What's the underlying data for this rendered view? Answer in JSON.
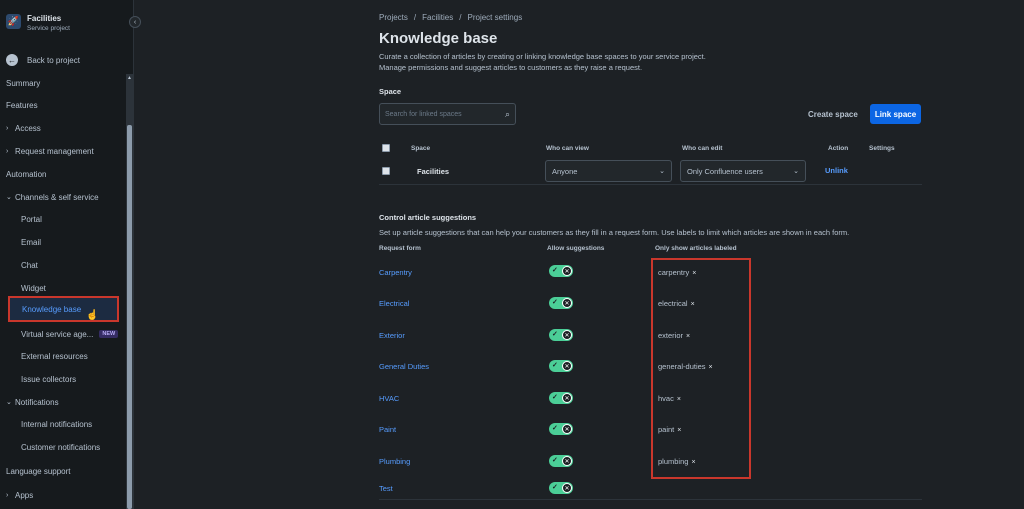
{
  "sidebar": {
    "project_name": "Facilities",
    "project_type": "Service project",
    "collapse_glyph": "‹",
    "back_label": "Back to project",
    "items": [
      {
        "label": "Summary"
      },
      {
        "label": "Features"
      },
      {
        "label": "Access"
      },
      {
        "label": "Request management"
      },
      {
        "label": "Automation"
      },
      {
        "label": "Channels & self service"
      },
      {
        "label": "Portal"
      },
      {
        "label": "Email"
      },
      {
        "label": "Chat"
      },
      {
        "label": "Widget"
      },
      {
        "label": "Knowledge base"
      },
      {
        "label": "Virtual service age..."
      },
      {
        "label": "External resources"
      },
      {
        "label": "Issue collectors"
      },
      {
        "label": "Notifications"
      },
      {
        "label": "Internal notifications"
      },
      {
        "label": "Customer notifications"
      },
      {
        "label": "Language support"
      },
      {
        "label": "Apps"
      }
    ],
    "new_badge": "NEW"
  },
  "breadcrumb": [
    "Projects",
    "Facilities",
    "Project settings"
  ],
  "page": {
    "title": "Knowledge base",
    "description_line1": "Curate a collection of articles by creating or linking knowledge base spaces to your service project.",
    "description_line2": "Manage permissions and suggest articles to customers as they raise a request."
  },
  "space": {
    "label": "Space",
    "search_placeholder": "Search for linked spaces",
    "create_button": "Create space",
    "link_button": "Link space",
    "headers": {
      "space": "Space",
      "who_view": "Who can view",
      "who_edit": "Who can edit",
      "action": "Action",
      "settings": "Settings"
    },
    "row": {
      "name": "Facilities",
      "who_view": "Anyone",
      "who_edit": "Only Confluence users",
      "action": "Unlink"
    }
  },
  "suggestions": {
    "title": "Control article suggestions",
    "description": "Set up article suggestions that can help your customers as they fill in a request form. Use labels to limit which articles are shown in each form.",
    "headers": {
      "form": "Request form",
      "allow": "Allow suggestions",
      "labels": "Only show articles labeled"
    },
    "rows": [
      {
        "form": "Carpentry",
        "label": "carpentry"
      },
      {
        "form": "Electrical",
        "label": "electrical"
      },
      {
        "form": "Exterior",
        "label": "exterior"
      },
      {
        "form": "General Duties",
        "label": "general-duties"
      },
      {
        "form": "HVAC",
        "label": "hvac"
      },
      {
        "form": "Paint",
        "label": "paint"
      },
      {
        "form": "Plumbing",
        "label": "plumbing"
      },
      {
        "form": "Test",
        "label": ""
      }
    ]
  },
  "colors": {
    "accent": "#0c66e4",
    "link": "#579dff",
    "toggle_on": "#4bce97",
    "highlight": "#c9372c"
  }
}
